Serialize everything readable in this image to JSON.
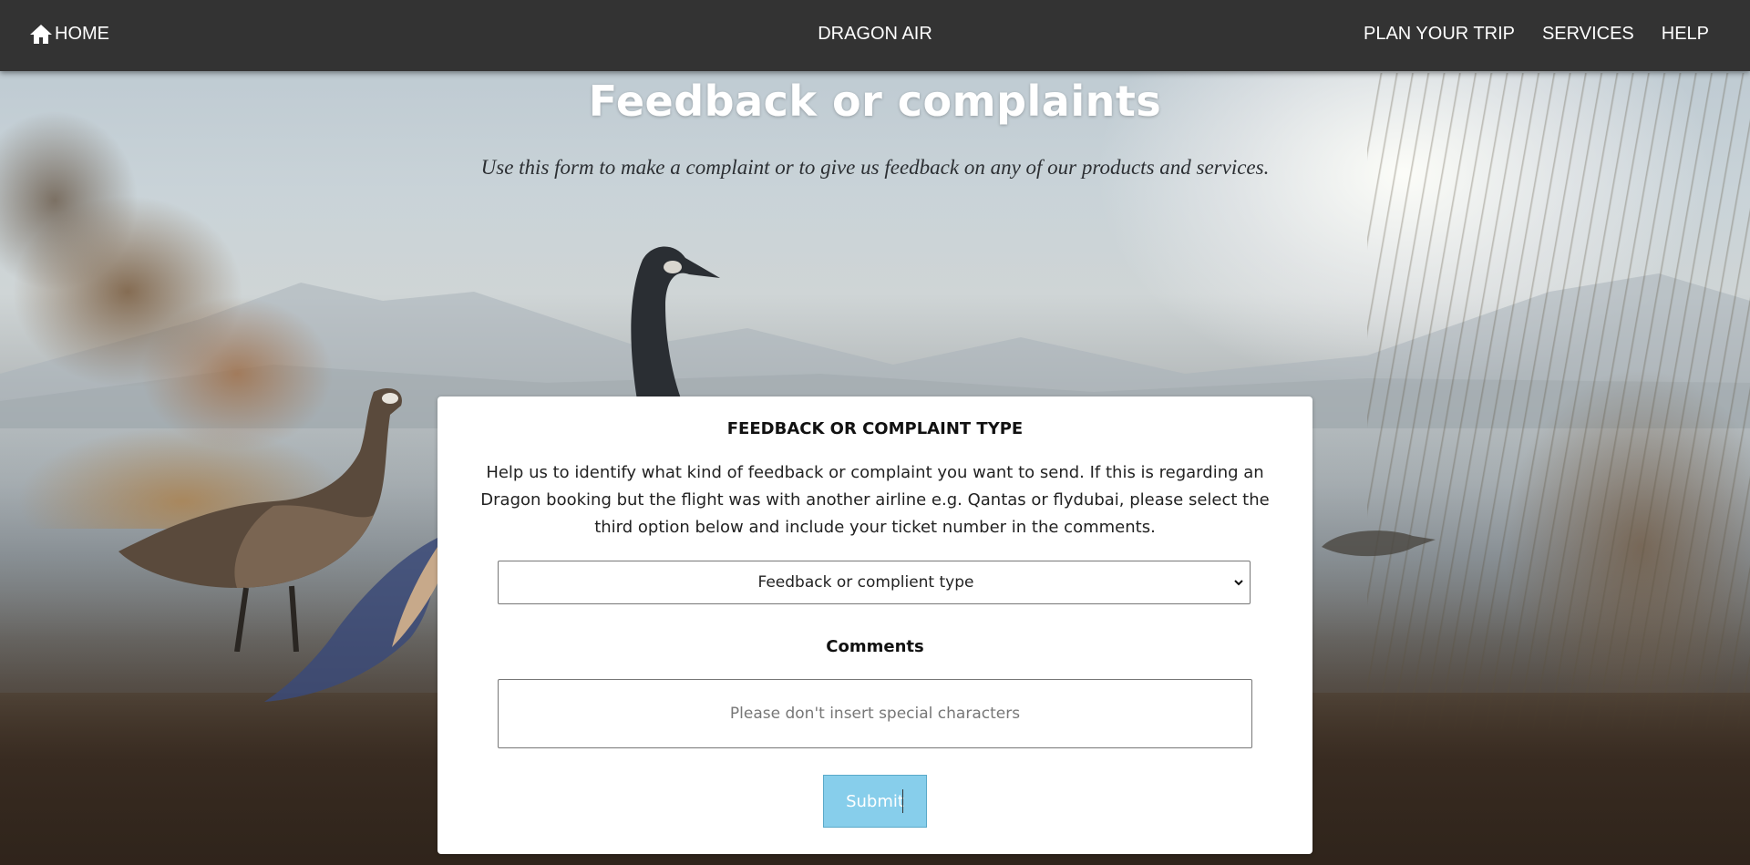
{
  "nav": {
    "home_label": "HOME",
    "brand": "DRAGON AIR",
    "links": [
      "PLAN YOUR TRIP",
      "SERVICES",
      "HELP"
    ]
  },
  "hero": {
    "title": "Feedback or complaints",
    "subtitle": "Use this form to make a complaint or to give us feedback on any of our products and services."
  },
  "form": {
    "heading": "FEEDBACK OR COMPLAINT TYPE",
    "description": "Help us to identify what kind of feedback or complaint you want to send. If this is regarding an Dragon booking but the flight was with another airline e.g. Qantas or flydubai, please select the third option below and include your ticket number in the comments.",
    "type_select": {
      "selected": "Feedback or complient type"
    },
    "comments_label": "Comments",
    "comments_placeholder": "Please don't insert special characters",
    "comments_value": "",
    "submit_label": "Submit"
  },
  "colors": {
    "navbar_bg": "#333333",
    "submit_bg": "#87ceeb",
    "card_bg": "#ffffff"
  },
  "icons": {
    "home": "home-icon",
    "select_chevron": "chevron-down-icon"
  }
}
